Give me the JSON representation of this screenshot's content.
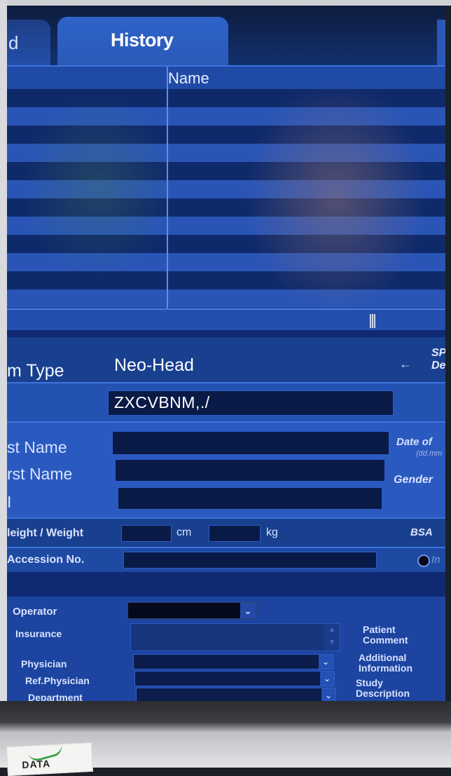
{
  "tabs": {
    "prev_partial": "d",
    "active": "History"
  },
  "history": {
    "column_name": "Name"
  },
  "exam": {
    "label": "m Type",
    "value": "Neo-Head",
    "arrow": "←",
    "sp_line1": "SP",
    "sp_line2": "De"
  },
  "patient_id": {
    "value": "ZXCVBNM,./"
  },
  "names": {
    "last_label": "st Name",
    "first_label": "rst Name",
    "middle_label": "I"
  },
  "dob": {
    "label": "Date of",
    "hint": "(dd.mm"
  },
  "gender": {
    "label": "Gender"
  },
  "measurements": {
    "label": "leight / Weight",
    "cm_unit": "cm",
    "kg_unit": "kg",
    "bsa_label": "BSA"
  },
  "accession": {
    "label": "Accession No.",
    "radio_label": "In"
  },
  "lower": {
    "operator_label": "Operator",
    "insurance_label": "Insurance",
    "physician_label": "Physician",
    "ref_physician_label": "Ref.Physician",
    "department_label": "Department",
    "patient_comment_1": "Patient",
    "patient_comment_2": "Comment",
    "additional_info_1": "Additional",
    "additional_info_2": "Information",
    "study_desc_1": "Study",
    "study_desc_2": "Description",
    "dropdown_glyph": "⌄"
  },
  "paper": {
    "text": "DATA"
  },
  "colors": {
    "screen_bg": "#0a1a4d",
    "tab_active": "#2f63c9",
    "panel": "#1c3f8f",
    "field": "#0a1a47"
  }
}
